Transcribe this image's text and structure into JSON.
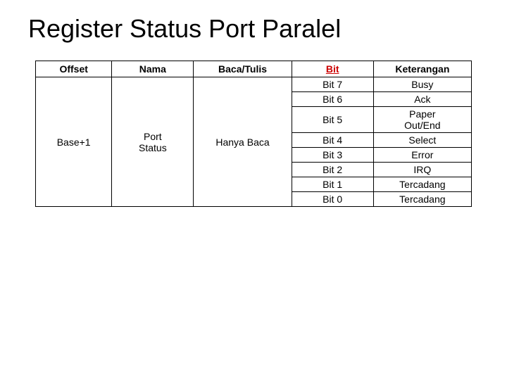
{
  "page": {
    "title": "Register Status Port Paralel"
  },
  "table": {
    "headers": [
      "Offset",
      "Nama",
      "Baca/Tulis",
      "Bit",
      "Keterangan"
    ],
    "rows": [
      {
        "offset": "Base+1",
        "nama": "Port Status",
        "baca": "Hanya Baca",
        "bits": [
          {
            "bit": "Bit 7",
            "ket": "Busy"
          },
          {
            "bit": "Bit 6",
            "ket": "Ack"
          },
          {
            "bit": "Bit 5",
            "ket": "Paper Out/End"
          },
          {
            "bit": "Bit 4",
            "ket": "Select"
          },
          {
            "bit": "Bit 3",
            "ket": "Error"
          },
          {
            "bit": "Bit 2",
            "ket": "IRQ"
          },
          {
            "bit": "Bit 1",
            "ket": "Tercadang"
          },
          {
            "bit": "Bit 0",
            "ket": "Tercadang"
          }
        ]
      }
    ]
  }
}
